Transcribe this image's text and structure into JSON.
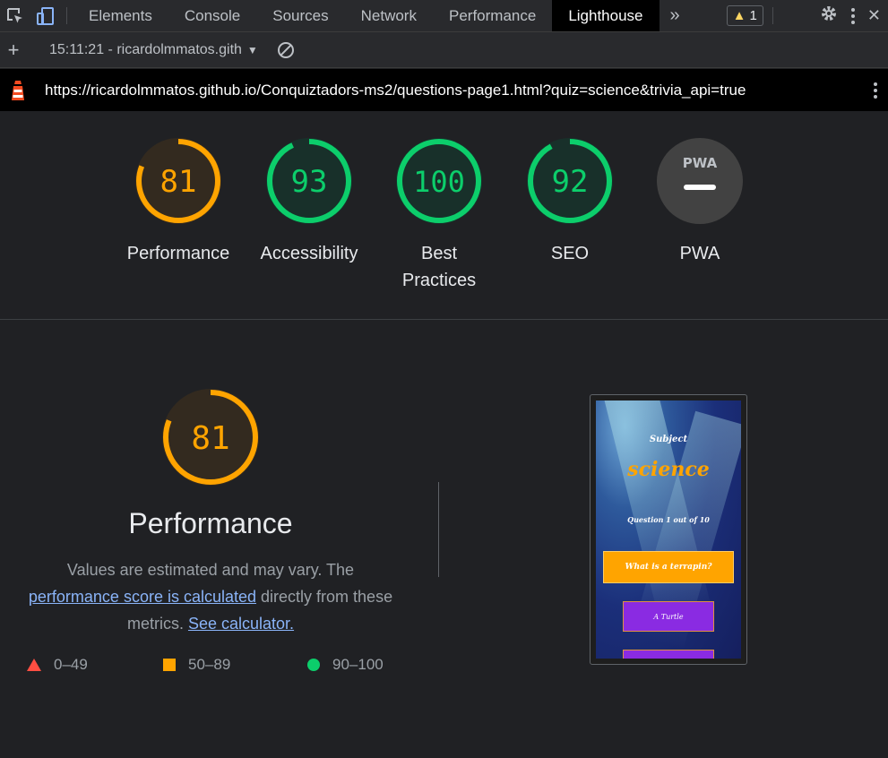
{
  "devtools": {
    "tabs": [
      "Elements",
      "Console",
      "Sources",
      "Network",
      "Performance",
      "Lighthouse"
    ],
    "active_tab": "Lighthouse",
    "more_tabs_icon": "chevron-double-right-icon",
    "warning_count": "1",
    "icons": [
      "inspect-element-icon",
      "device-toolbar-icon",
      "warning-icon",
      "settings-gear-icon",
      "kebab-menu-icon",
      "close-icon"
    ]
  },
  "toolbar": {
    "report_label": "15:11:21 - ricardolmmatos.gith",
    "add_icon": "plus-icon",
    "clear_icon": "block-icon"
  },
  "urlbar": {
    "url": "https://ricardolmmatos.github.io/Conquiztadors-ms2/questions-page1.html?quiz=science&trivia_api=true",
    "logo_icon": "lighthouse-icon"
  },
  "gauges": [
    {
      "score": "81",
      "fraction": 0.81,
      "label": "Performance",
      "color": "#ffa400",
      "bg": "#332a1f"
    },
    {
      "score": "93",
      "fraction": 0.93,
      "label": "Accessibility",
      "color": "#0cce6b",
      "bg": "#18302a"
    },
    {
      "score": "100",
      "fraction": 1.0,
      "label": "Best Practices",
      "color": "#0cce6b",
      "bg": "#18302a"
    },
    {
      "score": "92",
      "fraction": 0.92,
      "label": "SEO",
      "color": "#0cce6b",
      "bg": "#18302a"
    },
    {
      "score": "PWA",
      "fraction": 0,
      "label": "PWA",
      "color": "#e8eaed",
      "bg": "#424242"
    }
  ],
  "performance": {
    "score": "81",
    "fraction": 0.81,
    "title": "Performance",
    "desc_1": "Values are estimated and may vary. The",
    "link_1": "performance score is calculated",
    "desc_2": "directly from these metrics.",
    "link_2": "See calculator.",
    "color": "#ffa400"
  },
  "legend": [
    {
      "range": "0–49",
      "shape": "triangle",
      "color": "#ff4e42"
    },
    {
      "range": "50–89",
      "shape": "square",
      "color": "#ffa400"
    },
    {
      "range": "90–100",
      "shape": "circle",
      "color": "#0cce6b"
    }
  ],
  "screenshot": {
    "subject_label": "Subject",
    "quiz_name": "science",
    "question_counter": "Question 1 out of 10",
    "question": "What is a terrapin?",
    "answer_1": "A Turtle",
    "answer_2": ""
  }
}
